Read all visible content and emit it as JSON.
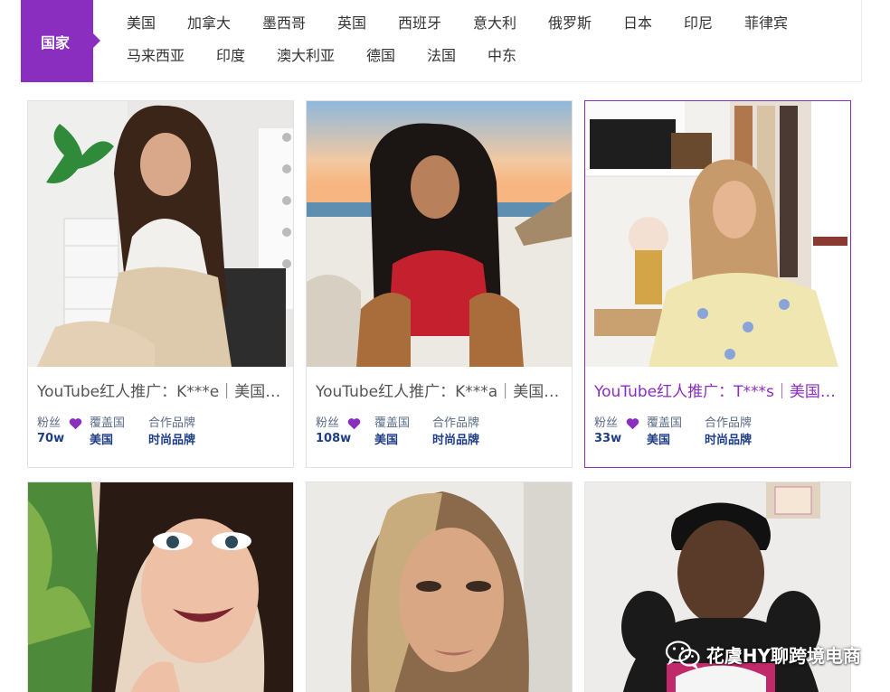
{
  "filter": {
    "label": "国家",
    "countries": [
      "美国",
      "加拿大",
      "墨西哥",
      "英国",
      "西班牙",
      "意大利",
      "俄罗斯",
      "日本",
      "印尼",
      "菲律宾",
      "马来西亚",
      "印度",
      "澳大利亚",
      "德国",
      "法国",
      "中东"
    ]
  },
  "meta_labels": {
    "fans": "粉丝",
    "coverage": "覆盖国",
    "brand": "合作品牌"
  },
  "cards": [
    {
      "title": "YouTube红人推广：K***e｜美国｜时尚",
      "fans": "70w",
      "coverage": "美国",
      "brand": "时尚品牌",
      "active": false
    },
    {
      "title": "YouTube红人推广：K***a｜美国｜时尚",
      "fans": "108w",
      "coverage": "美国",
      "brand": "时尚品牌",
      "active": false
    },
    {
      "title": "YouTube红人推广：T***s｜美国｜时尚",
      "fans": "33w",
      "coverage": "美国",
      "brand": "时尚品牌",
      "active": true
    }
  ],
  "watermark": {
    "text": "花虞HY聊跨境电商",
    "icon": "wechat-icon"
  },
  "colors": {
    "accent": "#8a2ec0",
    "meta_value": "#1f3e86",
    "meta_label": "#5a6b88"
  }
}
